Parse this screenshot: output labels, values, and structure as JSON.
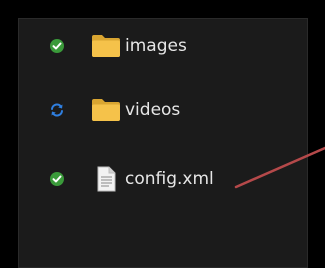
{
  "file_list": {
    "items": [
      {
        "name": "images",
        "type": "folder",
        "sync_status": "synced"
      },
      {
        "name": "videos",
        "type": "folder",
        "sync_status": "syncing"
      },
      {
        "name": "config.xml",
        "type": "file",
        "sync_status": "synced"
      }
    ]
  },
  "colors": {
    "background": "#000000",
    "panel": "#1b1b1b",
    "text": "#e6e6e6",
    "synced_green": "#3a9a3a",
    "syncing_blue": "#2f7fe0",
    "folder_yellow": "#f5c24a",
    "arrow": "#b5494a"
  },
  "icons": {
    "synced": "check-circle-icon",
    "syncing": "sync-arrows-icon",
    "folder": "folder-icon",
    "file": "document-icon"
  }
}
